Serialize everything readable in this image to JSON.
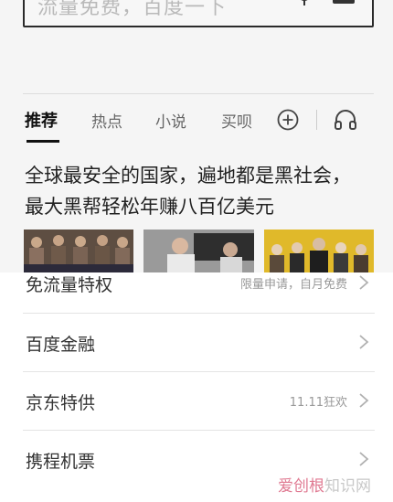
{
  "search": {
    "placeholder": "流量免费，百度一下"
  },
  "tabs": [
    {
      "label": "推荐"
    },
    {
      "label": "热点"
    },
    {
      "label": "小说"
    },
    {
      "label": "买呗"
    }
  ],
  "news": {
    "headline_line1": "全球最安全的国家，遍地都是黑社会，",
    "headline_line2": "最大黑帮轻松年赚八百亿美元"
  },
  "list": {
    "item0": {
      "label": "免流量特权",
      "sub": "限量申请，自月免费"
    },
    "item1": {
      "label": "百度金融"
    },
    "item2": {
      "label": "京东特供",
      "sub": "11.11狂欢"
    },
    "item3": {
      "label": "携程机票"
    }
  },
  "watermark": {
    "part1": "爱创根",
    "part2": "知识网"
  },
  "colors": {
    "accent": "#111111",
    "watermark": "#e07a92",
    "chevron": "#b0b0b0"
  }
}
